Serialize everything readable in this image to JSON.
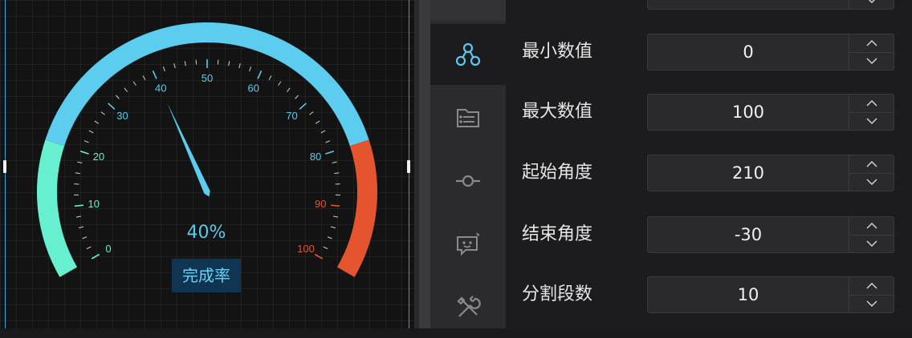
{
  "gauge": {
    "min": 0,
    "max": 100,
    "value": 40,
    "start_angle": 210,
    "end_angle": -30,
    "split_number": 10,
    "value_text": "40%",
    "title": "完成率",
    "color_stops": [
      {
        "until": 0.2,
        "color": "#67f0cf"
      },
      {
        "until": 0.8,
        "color": "#5ccdee"
      },
      {
        "until": 1.0,
        "color": "#e4552f"
      }
    ],
    "tick_labels": [
      "0",
      "10",
      "20",
      "30",
      "40",
      "50",
      "60",
      "70",
      "80",
      "90",
      "100"
    ],
    "pointer_color": "#5ccdee"
  },
  "sidebar": {
    "items": [
      {
        "icon": "nodes-icon",
        "active": true
      },
      {
        "icon": "list-file-icon",
        "active": false
      },
      {
        "icon": "commit-node-icon",
        "active": false
      },
      {
        "icon": "chat-bubble-icon",
        "active": false
      },
      {
        "icon": "tools-icon",
        "active": false
      }
    ]
  },
  "properties": {
    "fields": [
      {
        "label": "最小数值",
        "value": "0"
      },
      {
        "label": "最大数值",
        "value": "100"
      },
      {
        "label": "起始角度",
        "value": "210"
      },
      {
        "label": "结束角度",
        "value": "-30"
      },
      {
        "label": "分割段数",
        "value": "10"
      }
    ]
  },
  "colors": {
    "accent": "#5ccdee",
    "sidebar_active_icon": "#5bc8ec",
    "sidebar_icon": "#8a8a8c"
  }
}
